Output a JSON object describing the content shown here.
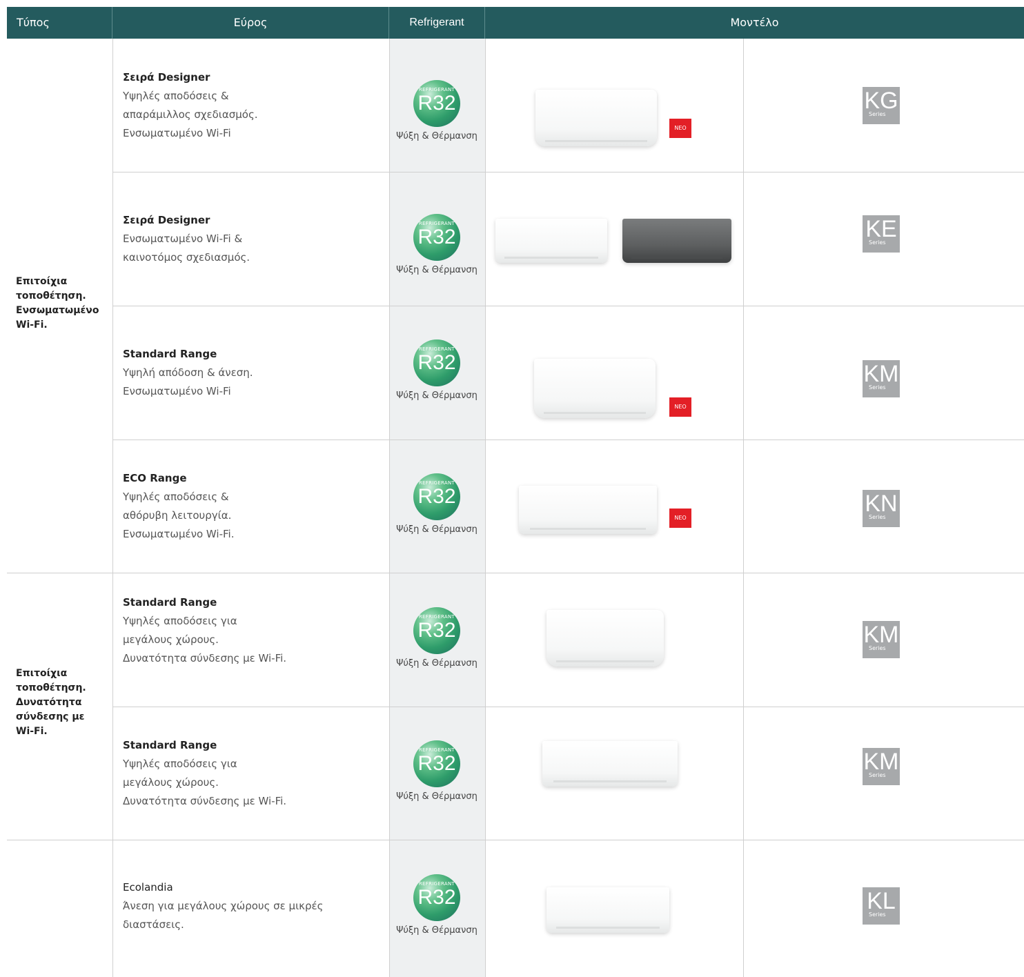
{
  "header": {
    "type": "Τύπος",
    "range": "Εύρος",
    "refrigerant": "Refrigerant",
    "model": "Μοντέλο"
  },
  "colors": {
    "header_bg": "#245b5e",
    "neo_badge": "#e31f26",
    "model_badge": "#a7a9ab"
  },
  "groups": [
    {
      "type": "Επιτοίχια τοποθέτηση. Ενσωματωμένο Wi-Fi."
    },
    {
      "type": "Επιτοίχια τοποθέτηση. Δυνατότητα σύνδεσης με Wi-Fi."
    }
  ],
  "rows": [
    {
      "title": "Σειρά Designer",
      "lines": [
        "Υψηλές αποδόσεις &",
        "απαράμιλλος σχεδιασμός.",
        "Ενσωματωμένο Wi-Fi"
      ],
      "ref_top": "REFRIGERANT",
      "ref_code": "R32",
      "mode": "Ψύξη & Θέρμανση",
      "neo": "NEO",
      "model": "KG",
      "series": "Series"
    },
    {
      "title": "Σειρά Designer",
      "lines": [
        "Ενσωματωμένο Wi-Fi &",
        "καινοτόμος σχεδιασμός."
      ],
      "ref_top": "REFRIGERANT",
      "ref_code": "R32",
      "mode": "Ψύξη & Θέρμανση",
      "neo": "",
      "model": "KE",
      "series": "Series"
    },
    {
      "title": "Standard Range",
      "lines": [
        "Υψηλή απόδοση & άνεση.",
        "Ενσωματωμένο Wi-Fi"
      ],
      "ref_top": "REFRIGERANT",
      "ref_code": "R32",
      "mode": "Ψύξη & Θέρμανση",
      "neo": "NEO",
      "model": "KM",
      "series": "Series"
    },
    {
      "title": "ECO Range",
      "lines": [
        "Υψηλές αποδόσεις &",
        "αθόρυβη λειτουργία.",
        "Ενσωματωμένο Wi-Fi."
      ],
      "ref_top": "REFRIGERANT",
      "ref_code": "R32",
      "mode": "Ψύξη & Θέρμανση",
      "neo": "NEO",
      "model": "KN",
      "series": "Series"
    },
    {
      "title": "Standard Range",
      "lines": [
        "Υψηλές αποδόσεις για",
        "μεγάλους χώρους.",
        "Δυνατότητα σύνδεσης με Wi-Fi."
      ],
      "ref_top": "REFRIGERANT",
      "ref_code": "R32",
      "mode": "Ψύξη & Θέρμανση",
      "neo": "",
      "model": "KM",
      "series": "Series"
    },
    {
      "title": "Standard Range",
      "lines": [
        "Υψηλές αποδόσεις για",
        "μεγάλους χώρους.",
        "Δυνατότητα σύνδεσης με Wi-Fi."
      ],
      "ref_top": "REFRIGERANT",
      "ref_code": "R32",
      "mode": "Ψύξη & Θέρμανση",
      "neo": "",
      "model": "KM",
      "series": "Series"
    },
    {
      "title": "Ecolandia",
      "lines": [
        "Άνεση για μεγάλους χώρους σε μικρές",
        "διαστάσεις."
      ],
      "ref_top": "REFRIGERANT",
      "ref_code": "R32",
      "mode": "Ψύξη & Θέρμανση",
      "neo": "",
      "model": "KL",
      "series": "Series"
    }
  ]
}
